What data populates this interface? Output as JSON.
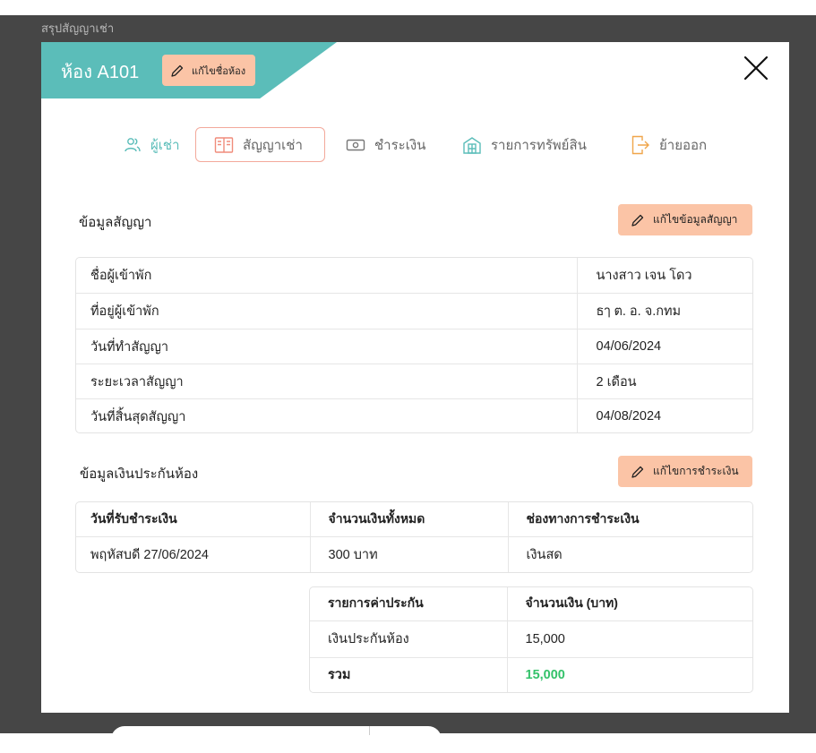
{
  "background": {
    "page_title": "สรุปสัญญาเช่า"
  },
  "modal": {
    "room_title": "ห้อง A101",
    "rename_label": "แก้ไขชื่อห้อง",
    "close_icon": "close-x-icon"
  },
  "tabs": [
    {
      "label": "ผู้เช่า",
      "icon": "users-icon",
      "active": false
    },
    {
      "label": "สัญญาเช่า",
      "icon": "book-icon",
      "active": true
    },
    {
      "label": "ชำระเงิน",
      "icon": "money-icon",
      "active": false
    },
    {
      "label": "รายการทรัพย์สิน",
      "icon": "building-icon",
      "active": false
    },
    {
      "label": "ย้ายออก",
      "icon": "exit-icon",
      "active": false
    }
  ],
  "contract_section": {
    "title": "ข้อมูลสัญญา",
    "edit_label": "แก้ไขข้อมูลสัญญา",
    "rows": [
      {
        "label": "ชื่อผู้เข้าพัก",
        "value": "นางสาว เจน โดว"
      },
      {
        "label": "ที่อยู่ผู้เข้าพัก",
        "value": "ธๅ ต. อ. จ.กทม"
      },
      {
        "label": "วันที่ทำสัญญา",
        "value": "04/06/2024"
      },
      {
        "label": "ระยะเวลาสัญญา",
        "value": "2 เดือน"
      },
      {
        "label": "วันที่สิ้นสุดสัญญา",
        "value": "04/08/2024"
      }
    ]
  },
  "deposit_section": {
    "title": "ข้อมูลเงินประกันห้อง",
    "edit_label": "แก้ไขการชำระเงิน",
    "payment_headers": [
      "วันที่รับชำระเงิน",
      "จำนวนเงินทั้งหมด",
      "ช่องทางการชำระเงิน"
    ],
    "payment_row": [
      "พฤหัสบดี 27/06/2024",
      "300 บาท",
      "เงินสด"
    ],
    "deposit_headers": [
      "รายการค่าประกัน",
      "จำนวนเงิน (บาท)"
    ],
    "deposit_items": [
      {
        "label": "เงินประกันห้อง",
        "amount": "15,000"
      }
    ],
    "total_label": "รวม",
    "total_amount": "15,000"
  },
  "colors": {
    "accent_teal": "#5bbdb9",
    "button_peach": "#fbc4a6",
    "active_tab_border": "#f3a99b",
    "total_green": "#34c26a",
    "backdrop": "#464646"
  }
}
